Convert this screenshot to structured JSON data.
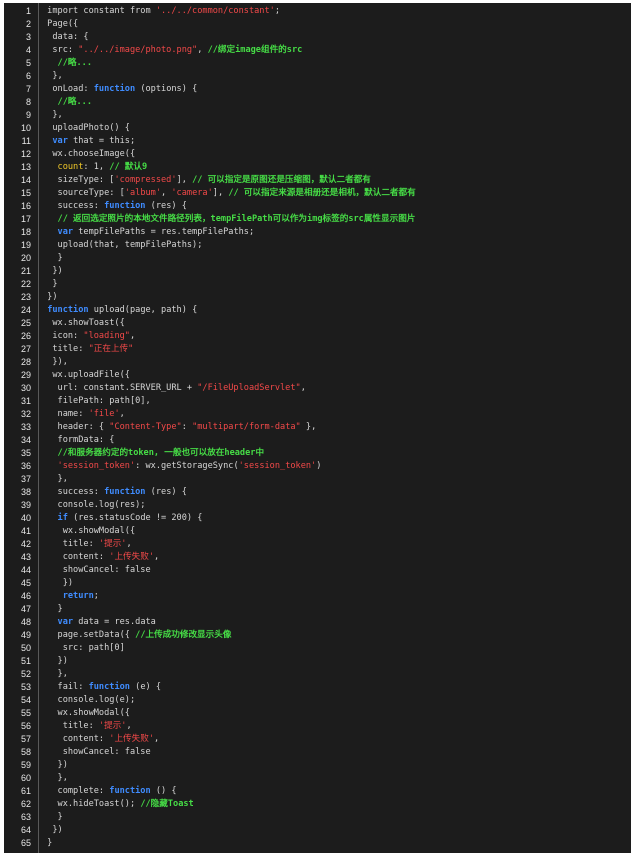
{
  "editor": {
    "colors": {
      "background": "#1c1c1c",
      "text": "#d6d6d6",
      "keyword": "#3f8cff",
      "string": "#f24949",
      "comment": "#46dc46",
      "property": "#f0c828"
    },
    "lines": [
      {
        "n": "1",
        "t": [
          [
            "p",
            " import constant from "
          ],
          [
            "s",
            "'../../common/constant'"
          ],
          [
            "p",
            ";"
          ]
        ]
      },
      {
        "n": "2",
        "t": [
          [
            "p",
            " Page({"
          ]
        ]
      },
      {
        "n": "3",
        "t": [
          [
            "p",
            "  data: {"
          ]
        ]
      },
      {
        "n": "4",
        "t": [
          [
            "p",
            "  src: "
          ],
          [
            "s",
            "\"../../image/photo.png\""
          ],
          [
            "p",
            ", "
          ],
          [
            "c",
            "//绑定image组件的src"
          ]
        ]
      },
      {
        "n": "5",
        "t": [
          [
            "p",
            "   "
          ],
          [
            "c",
            "//略..."
          ]
        ]
      },
      {
        "n": "6",
        "t": [
          [
            "p",
            "  },"
          ]
        ]
      },
      {
        "n": "7",
        "t": [
          [
            "p",
            "  onLoad: "
          ],
          [
            "k",
            "function"
          ],
          [
            "p",
            " (options) {"
          ]
        ]
      },
      {
        "n": "8",
        "t": [
          [
            "p",
            "   "
          ],
          [
            "c",
            "//略..."
          ]
        ]
      },
      {
        "n": "9",
        "t": [
          [
            "p",
            "  },"
          ]
        ]
      },
      {
        "n": "10",
        "t": [
          [
            "p",
            "  uploadPhoto() {"
          ]
        ]
      },
      {
        "n": "11",
        "t": [
          [
            "p",
            "  "
          ],
          [
            "k",
            "var"
          ],
          [
            "p",
            " that = this;"
          ]
        ]
      },
      {
        "n": "12",
        "t": [
          [
            "p",
            "  wx.chooseImage({"
          ]
        ]
      },
      {
        "n": "13",
        "t": [
          [
            "p",
            "   "
          ],
          [
            "y",
            "count"
          ],
          [
            "p",
            ": 1, "
          ],
          [
            "c",
            "// 默认9"
          ]
        ]
      },
      {
        "n": "14",
        "t": [
          [
            "p",
            "   sizeType: ["
          ],
          [
            "s",
            "'compressed'"
          ],
          [
            "p",
            "], "
          ],
          [
            "c",
            "// 可以指定是原图还是压缩图，默认二者都有"
          ]
        ]
      },
      {
        "n": "15",
        "t": [
          [
            "p",
            "   sourceType: ["
          ],
          [
            "s",
            "'album'"
          ],
          [
            "p",
            ", "
          ],
          [
            "s",
            "'camera'"
          ],
          [
            "p",
            "], "
          ],
          [
            "c",
            "// 可以指定来源是相册还是相机，默认二者都有"
          ]
        ]
      },
      {
        "n": "16",
        "t": [
          [
            "p",
            "   success: "
          ],
          [
            "k",
            "function"
          ],
          [
            "p",
            " (res) {"
          ]
        ]
      },
      {
        "n": "17",
        "t": [
          [
            "p",
            "   "
          ],
          [
            "c",
            "// 返回选定照片的本地文件路径列表，tempFilePath可以作为img标签的src属性显示图片"
          ]
        ]
      },
      {
        "n": "18",
        "t": [
          [
            "p",
            "   "
          ],
          [
            "k",
            "var"
          ],
          [
            "p",
            " tempFilePaths = res.tempFilePaths;"
          ]
        ]
      },
      {
        "n": "19",
        "t": [
          [
            "p",
            "   upload(that, tempFilePaths);"
          ]
        ]
      },
      {
        "n": "20",
        "t": [
          [
            "p",
            "   }"
          ]
        ]
      },
      {
        "n": "21",
        "t": [
          [
            "p",
            "  })"
          ]
        ]
      },
      {
        "n": "22",
        "t": [
          [
            "p",
            "  }"
          ]
        ]
      },
      {
        "n": "23",
        "t": [
          [
            "p",
            " })"
          ]
        ]
      },
      {
        "n": "24",
        "t": [
          [
            "p",
            " "
          ],
          [
            "k",
            "function"
          ],
          [
            "p",
            " upload(page, path) {"
          ]
        ]
      },
      {
        "n": "25",
        "t": [
          [
            "p",
            "  wx.showToast({"
          ]
        ]
      },
      {
        "n": "26",
        "t": [
          [
            "p",
            "  icon: "
          ],
          [
            "s",
            "\"loading\""
          ],
          [
            "p",
            ","
          ]
        ]
      },
      {
        "n": "27",
        "t": [
          [
            "p",
            "  title: "
          ],
          [
            "s",
            "\"正在上传\""
          ]
        ]
      },
      {
        "n": "28",
        "t": [
          [
            "p",
            "  }),"
          ]
        ]
      },
      {
        "n": "29",
        "t": [
          [
            "p",
            "  wx.uploadFile({"
          ]
        ]
      },
      {
        "n": "30",
        "t": [
          [
            "p",
            "   url: constant.SERVER_URL + "
          ],
          [
            "s",
            "\"/FileUploadServlet\""
          ],
          [
            "p",
            ","
          ]
        ]
      },
      {
        "n": "31",
        "t": [
          [
            "p",
            "   filePath: path[0],"
          ]
        ]
      },
      {
        "n": "32",
        "t": [
          [
            "p",
            "   name: "
          ],
          [
            "s",
            "'file'"
          ],
          [
            "p",
            ","
          ]
        ]
      },
      {
        "n": "33",
        "t": [
          [
            "p",
            "   header: { "
          ],
          [
            "s",
            "\"Content-Type\""
          ],
          [
            "p",
            ": "
          ],
          [
            "s",
            "\"multipart/form-data\""
          ],
          [
            "p",
            " },"
          ]
        ]
      },
      {
        "n": "34",
        "t": [
          [
            "p",
            "   formData: {"
          ]
        ]
      },
      {
        "n": "35",
        "t": [
          [
            "p",
            "   "
          ],
          [
            "c",
            "//和服务器约定的token, 一般也可以放在header中"
          ]
        ]
      },
      {
        "n": "36",
        "t": [
          [
            "p",
            "   "
          ],
          [
            "s",
            "'session_token'"
          ],
          [
            "p",
            ": wx.getStorageSync("
          ],
          [
            "s",
            "'session_token'"
          ],
          [
            "p",
            ")"
          ]
        ]
      },
      {
        "n": "37",
        "t": [
          [
            "p",
            "   },"
          ]
        ]
      },
      {
        "n": "38",
        "t": [
          [
            "p",
            "   success: "
          ],
          [
            "k",
            "function"
          ],
          [
            "p",
            " (res) {"
          ]
        ]
      },
      {
        "n": "39",
        "t": [
          [
            "p",
            "   console.log(res);"
          ]
        ]
      },
      {
        "n": "40",
        "t": [
          [
            "p",
            "   "
          ],
          [
            "k",
            "if"
          ],
          [
            "p",
            " (res.statusCode != 200) {"
          ]
        ]
      },
      {
        "n": "41",
        "t": [
          [
            "p",
            "    wx.showModal({"
          ]
        ]
      },
      {
        "n": "42",
        "t": [
          [
            "p",
            "    title: "
          ],
          [
            "s",
            "'提示'"
          ],
          [
            "p",
            ","
          ]
        ]
      },
      {
        "n": "43",
        "t": [
          [
            "p",
            "    content: "
          ],
          [
            "s",
            "'上传失败'"
          ],
          [
            "p",
            ","
          ]
        ]
      },
      {
        "n": "44",
        "t": [
          [
            "p",
            "    showCancel: false"
          ]
        ]
      },
      {
        "n": "45",
        "t": [
          [
            "p",
            "    })"
          ]
        ]
      },
      {
        "n": "46",
        "t": [
          [
            "p",
            "    "
          ],
          [
            "k",
            "return"
          ],
          [
            "p",
            ";"
          ]
        ]
      },
      {
        "n": "47",
        "t": [
          [
            "p",
            "   }"
          ]
        ]
      },
      {
        "n": "48",
        "t": [
          [
            "p",
            "   "
          ],
          [
            "k",
            "var"
          ],
          [
            "p",
            " data = res.data"
          ]
        ]
      },
      {
        "n": "49",
        "t": [
          [
            "p",
            "   page.setData({ "
          ],
          [
            "c",
            "//上传成功修改显示头像"
          ]
        ]
      },
      {
        "n": "50",
        "t": [
          [
            "p",
            "    src: path[0]"
          ]
        ]
      },
      {
        "n": "51",
        "t": [
          [
            "p",
            "   })"
          ]
        ]
      },
      {
        "n": "52",
        "t": [
          [
            "p",
            "   },"
          ]
        ]
      },
      {
        "n": "53",
        "t": [
          [
            "p",
            "   fail: "
          ],
          [
            "k",
            "function"
          ],
          [
            "p",
            " (e) {"
          ]
        ]
      },
      {
        "n": "54",
        "t": [
          [
            "p",
            "   console.log(e);"
          ]
        ]
      },
      {
        "n": "55",
        "t": [
          [
            "p",
            "   wx.showModal({"
          ]
        ]
      },
      {
        "n": "56",
        "t": [
          [
            "p",
            "    title: "
          ],
          [
            "s",
            "'提示'"
          ],
          [
            "p",
            ","
          ]
        ]
      },
      {
        "n": "57",
        "t": [
          [
            "p",
            "    content: "
          ],
          [
            "s",
            "'上传失败'"
          ],
          [
            "p",
            ","
          ]
        ]
      },
      {
        "n": "58",
        "t": [
          [
            "p",
            "    showCancel: false"
          ]
        ]
      },
      {
        "n": "59",
        "t": [
          [
            "p",
            "   })"
          ]
        ]
      },
      {
        "n": "60",
        "t": [
          [
            "p",
            "   },"
          ]
        ]
      },
      {
        "n": "61",
        "t": [
          [
            "p",
            "   complete: "
          ],
          [
            "k",
            "function"
          ],
          [
            "p",
            " () {"
          ]
        ]
      },
      {
        "n": "62",
        "t": [
          [
            "p",
            "   wx.hideToast(); "
          ],
          [
            "c",
            "//隐藏Toast"
          ]
        ]
      },
      {
        "n": "63",
        "t": [
          [
            "p",
            "   }"
          ]
        ]
      },
      {
        "n": "64",
        "t": [
          [
            "p",
            "  })"
          ]
        ]
      },
      {
        "n": "65",
        "t": [
          [
            "p",
            " }"
          ]
        ]
      }
    ]
  }
}
